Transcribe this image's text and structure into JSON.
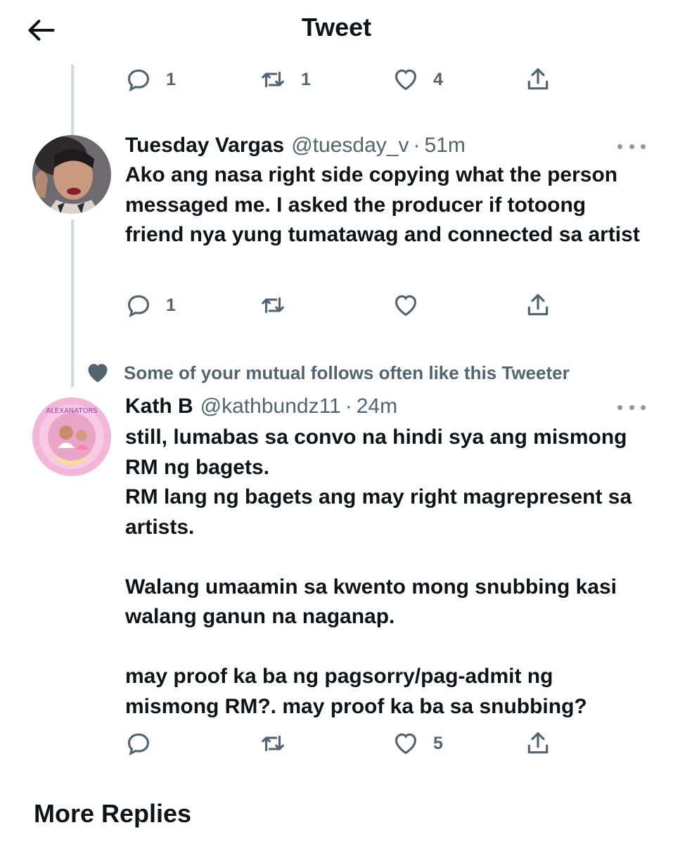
{
  "header": {
    "title": "Tweet",
    "back_icon": "arrow-left-icon"
  },
  "parent_tweet_actions": {
    "replies": "1",
    "retweets": "1",
    "likes": "4"
  },
  "tweets": [
    {
      "name": "Tuesday Vargas",
      "handle": "@tuesday_v",
      "separator": "·",
      "time": "51m",
      "text": "Ako ang nasa right side copying what the person messaged me. I asked the producer if totoong friend nya yung tumatawag and connected sa artist",
      "actions": {
        "replies": "1",
        "retweets": "",
        "likes": ""
      }
    },
    {
      "social_context": "Some of your mutual follows often like this Tweeter",
      "name": "Kath B",
      "handle": "@kathbundz11",
      "separator": "·",
      "time": "24m",
      "text": "still, lumabas sa convo na hindi sya ang mismong RM ng bagets.\nRM lang ng bagets ang may right magrepresent sa artists.\n\nWalang umaamin sa kwento mong snubbing kasi walang ganun na naganap.\n\nmay proof ka ba ng pagsorry/pag-admit ng mismong RM?. may proof ka ba sa snubbing?",
      "actions": {
        "replies": "",
        "retweets": "",
        "likes": "5"
      }
    }
  ],
  "footer": {
    "more_replies_label": "More Replies"
  },
  "colors": {
    "text": "#0f1419",
    "secondary": "#536471",
    "thread_line": "#cfd9de",
    "background": "#ffffff"
  }
}
